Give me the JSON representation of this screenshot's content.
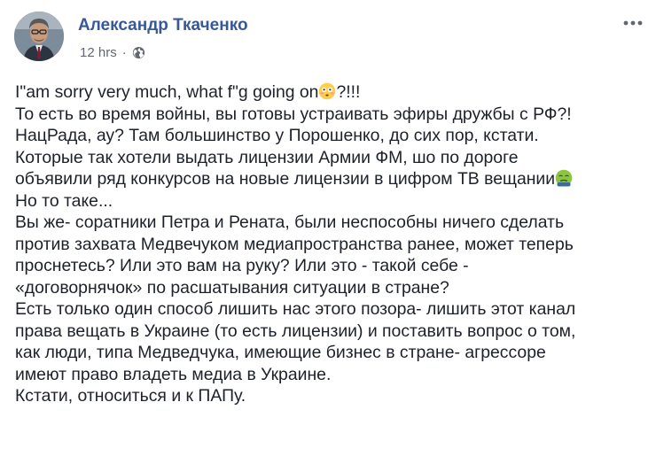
{
  "post": {
    "author": "Александр Ткаченко",
    "timestamp": "12 hrs",
    "separator": "·",
    "privacy_icon": "globe-icon",
    "more_icon": "more-options-icon",
    "lines": [
      "I\"am sorry very much, what f\"g going on",
      "?!!!",
      "То есть во время войны, вы готовы устраивать эфиры дружбы с РФ?!",
      "НацРада, ау? Там большинство у Порошенко, до сих пор, кстати.",
      "Которые так хотели выдать лицензии Армии ФМ, шо по дороге",
      "объявили ряд конкурсов на новые лицензии в цифром ТВ вещании",
      "Но то таке...",
      "Вы же- соратники Петра и Рената, были неспособны ничего сделать",
      "против захвата Медвечуком медиапространства ранее, может теперь",
      "проснетесь? Или это вам на руку? Или это - такой себе -",
      "«договорнячок» по расшатывания ситуации в стране?",
      "Есть только один способ лишить нас этого позора- лишить этот канал",
      "права вещать в Украине (то есть лицензии) и поставить вопрос о том,",
      "как люди, типа Медведчука, имеющие бизнес в стране- агрессоре",
      "имеют право владеть медиа в Украине.",
      "Кстати, относиться и к ПАПу."
    ],
    "emoji_1": "flushed-face-emoji",
    "emoji_2": "nauseated-face-emoji"
  },
  "colors": {
    "author": "#385898",
    "text": "#1d2129",
    "meta": "#606770"
  }
}
